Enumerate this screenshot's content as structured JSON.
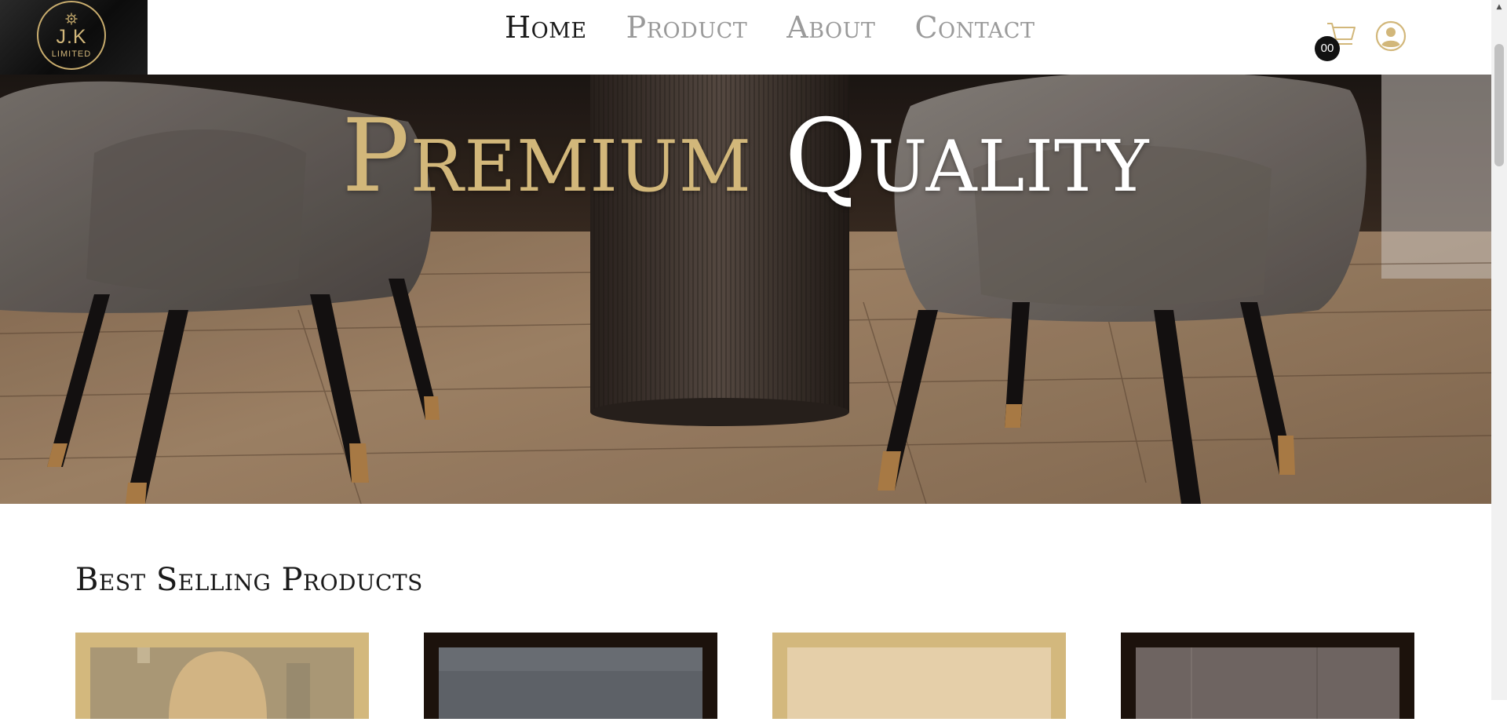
{
  "logo": {
    "text": "J.K",
    "subtext": "LIMITED"
  },
  "nav": {
    "items": [
      {
        "label": "Home",
        "active": true
      },
      {
        "label": "Product",
        "active": false
      },
      {
        "label": "About",
        "active": false
      },
      {
        "label": "Contact",
        "active": false
      }
    ]
  },
  "cart": {
    "count": "00",
    "icon": "cart-icon"
  },
  "user": {
    "icon": "user-icon"
  },
  "hero": {
    "title_word1": "Premium",
    "title_word2": "Quality",
    "accent_color": "#d2b77a"
  },
  "best_selling": {
    "title": "Best Selling Products",
    "cards": [
      {
        "frame": "gold"
      },
      {
        "frame": "dark"
      },
      {
        "frame": "gold"
      },
      {
        "frame": "dark"
      }
    ]
  },
  "colors": {
    "gold": "#d3b87d",
    "dark": "#1c120c",
    "text_dark": "#1a1a1a",
    "nav_inactive": "#9a9a9a"
  }
}
